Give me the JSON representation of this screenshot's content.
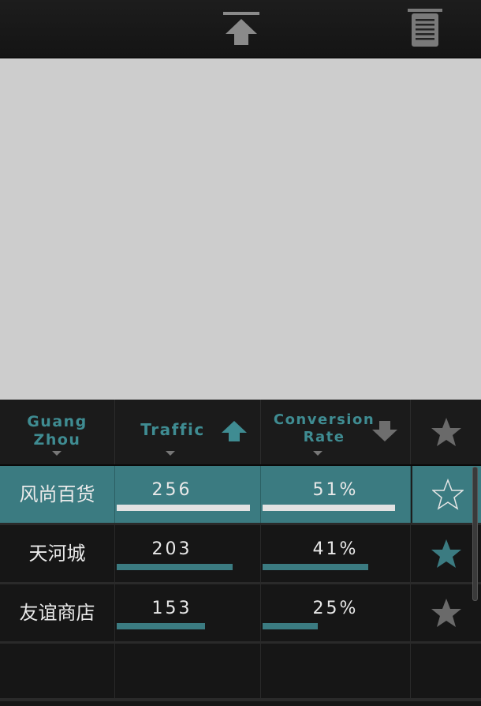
{
  "toolbar": {
    "upload_icon": "upload-arrow-icon",
    "trash_icon": "trash-icon"
  },
  "table": {
    "columns": [
      {
        "label": "Guang\nZhou",
        "sort": "none"
      },
      {
        "label": "Traffic",
        "sort": "ascending"
      },
      {
        "label": "Conversion\nRate",
        "sort": "descending"
      },
      {
        "label": "",
        "icon": "star-icon"
      }
    ],
    "rows": [
      {
        "city": "风尚百货",
        "traffic": "256",
        "traffic_ratio": 0.92,
        "conversion": "51%",
        "conversion_ratio": 0.89,
        "favorite": false,
        "selected": true
      },
      {
        "city": "天河城",
        "traffic": "203",
        "traffic_ratio": 0.8,
        "conversion": "41%",
        "conversion_ratio": 0.71,
        "favorite": true,
        "selected": false
      },
      {
        "city": "友谊商店",
        "traffic": "153",
        "traffic_ratio": 0.61,
        "conversion": "25%",
        "conversion_ratio": 0.37,
        "favorite": true,
        "selected": false
      }
    ]
  },
  "colors": {
    "accent": "#3b7b81",
    "header_text": "#3f8c92",
    "star_active": "#3b7b81",
    "star_inactive": "#6a6a6a",
    "background": "#161616",
    "blank_panel": "#cdcdcd"
  }
}
